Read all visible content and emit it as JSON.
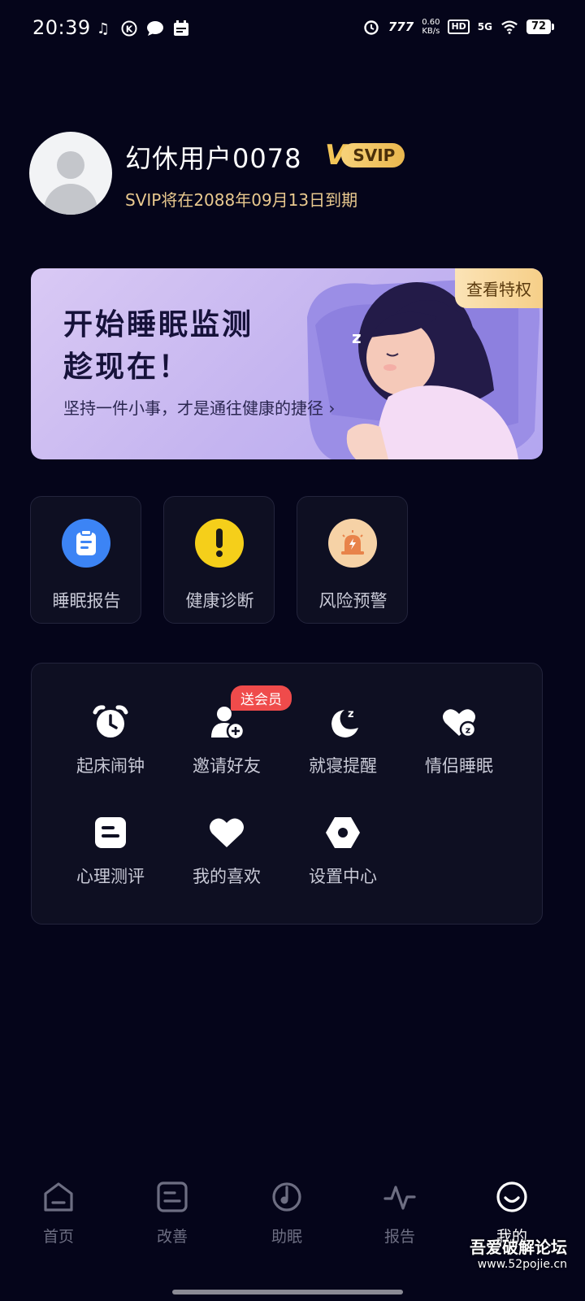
{
  "status_bar": {
    "time": "20:39",
    "left_icons": [
      "music-note-icon",
      "k-app-icon",
      "chat-bubble-icon",
      "calendar-icon"
    ],
    "alarm_icon": "alarm-icon",
    "nfc_label": "777",
    "net_speed": "0.60",
    "net_speed_unit": "KB/s",
    "hd_label": "HD",
    "signal_label": "5G",
    "wifi_icon": "wifi-icon",
    "battery": "72"
  },
  "profile": {
    "name": "幻休用户0078",
    "badge_v": "V",
    "badge_label": "SVIP",
    "expire_text": "SVIP将在2088年09月13日到期"
  },
  "banner": {
    "title_line1": "开始睡眠监测",
    "title_line2": "趁现在！",
    "subtitle": "坚持一件小事，才是通往健康的捷径 ›",
    "badge": "查看特权"
  },
  "quick_actions": [
    {
      "label": "睡眠报告",
      "icon": "clipboard-icon",
      "color": "#3c84f5"
    },
    {
      "label": "健康诊断",
      "icon": "exclamation-icon",
      "color": "#f5cf1a"
    },
    {
      "label": "风险预警",
      "icon": "siren-icon",
      "color": "#f6d2a6"
    }
  ],
  "grid": {
    "promo_tag": "送会员",
    "items": [
      {
        "label": "起床闹钟",
        "icon": "alarm-clock-icon"
      },
      {
        "label": "邀请好友",
        "icon": "add-user-icon"
      },
      {
        "label": "就寝提醒",
        "icon": "moon-zz-icon"
      },
      {
        "label": "情侣睡眠",
        "icon": "heart-zz-icon"
      },
      {
        "label": "心理测评",
        "icon": "document-icon"
      },
      {
        "label": "我的喜欢",
        "icon": "heart-icon"
      },
      {
        "label": "设置中心",
        "icon": "hex-gear-icon"
      }
    ]
  },
  "bottom_nav": [
    {
      "label": "首页",
      "icon": "home-icon",
      "active": false
    },
    {
      "label": "改善",
      "icon": "improve-icon",
      "active": false
    },
    {
      "label": "助眠",
      "icon": "sleep-aid-icon",
      "active": false
    },
    {
      "label": "报告",
      "icon": "pulse-icon",
      "active": false
    },
    {
      "label": "我的",
      "icon": "smile-icon",
      "active": true
    }
  ],
  "watermark": {
    "title": "吾爱破解论坛",
    "url": "www.52pojie.cn"
  }
}
